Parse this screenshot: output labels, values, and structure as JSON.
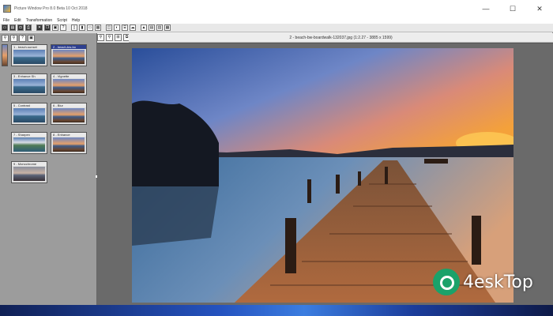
{
  "window": {
    "title": "Picture Window Pro 8.0 Beta 10 Oct 2018",
    "controls": [
      "—",
      "☐",
      "✕"
    ]
  },
  "menu": [
    "File",
    "Edit",
    "Transformation",
    "Script",
    "Help"
  ],
  "toolbar": {
    "buttons": [
      {
        "name": "toolbar-new-icon",
        "glyph": "▭"
      },
      {
        "name": "toolbar-open-icon",
        "glyph": "▤"
      },
      {
        "name": "toolbar-save-icon",
        "glyph": "◘"
      },
      {
        "name": "toolbar-print-icon",
        "glyph": "⎙"
      },
      {
        "name": "toolbar-close-icon",
        "glyph": "✕"
      },
      {
        "name": "toolbar-copy-icon",
        "glyph": "❐"
      },
      {
        "name": "toolbar-paste-icon",
        "glyph": "▣"
      },
      {
        "name": "toolbar-help-icon",
        "glyph": "?"
      },
      {
        "name": "toolbar-scroll-icon",
        "glyph": "▯"
      },
      {
        "name": "toolbar-page-icon",
        "glyph": "▮"
      },
      {
        "name": "toolbar-view-icon",
        "glyph": "▭"
      },
      {
        "name": "toolbar-grid-icon",
        "glyph": "▦"
      },
      {
        "name": "toolbar-select-icon",
        "glyph": "◫"
      },
      {
        "name": "toolbar-mask-icon",
        "glyph": "◐"
      },
      {
        "name": "toolbar-ruler-icon",
        "glyph": "⌸"
      },
      {
        "name": "toolbar-cloud-icon",
        "glyph": "☁"
      },
      {
        "name": "toolbar-landscape-icon",
        "glyph": "▲"
      },
      {
        "name": "toolbar-layers-icon",
        "glyph": "▤"
      },
      {
        "name": "toolbar-panels-icon",
        "glyph": "▥"
      },
      {
        "name": "toolbar-table-icon",
        "glyph": "▦"
      }
    ]
  },
  "left_panel": {
    "tools": [
      "⚲",
      "⚲",
      "?",
      "▣"
    ],
    "thumbnails": [
      {
        "label": "1 - beach-sunset",
        "style": "img-lake",
        "selected": false
      },
      {
        "label": "2 - beach-bw-bo",
        "style": "img-dock",
        "selected": true
      },
      {
        "label": "3 - Enhance Sh",
        "style": "img-lake",
        "selected": false
      },
      {
        "label": "4 - Vignette",
        "style": "img-dock",
        "selected": false
      },
      {
        "label": "5 - Contrast",
        "style": "img-lake",
        "selected": false
      },
      {
        "label": "6 - Blur",
        "style": "img-dock",
        "selected": false
      },
      {
        "label": "7 - Sharpen",
        "style": "img-mnt",
        "selected": false
      },
      {
        "label": "8 - Enhance",
        "style": "img-dock",
        "selected": false
      },
      {
        "label": "9 - Monochrome",
        "style": "img-mono",
        "selected": false
      }
    ]
  },
  "main": {
    "tools": [
      "⚲",
      "⚲",
      "⊞",
      "⧉"
    ],
    "doc_title": "2 - beach-bw-boardwalk-132037.jpg (1:2.27 - 3885 x 1599)"
  },
  "watermark": {
    "text": "4eskTop"
  }
}
